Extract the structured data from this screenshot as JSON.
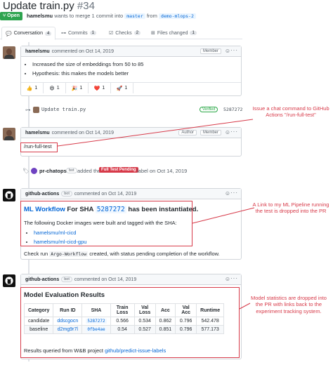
{
  "header": {
    "title": "Update train.py",
    "number": "#34",
    "status": "Open",
    "author": "hamelsmu",
    "merge_text": "wants to merge 1 commit into",
    "base_branch": "master",
    "from_text": "from",
    "head_branch": "demo-mlops-2"
  },
  "tabs": [
    {
      "label": "Conversation",
      "count": "4"
    },
    {
      "label": "Commits",
      "count": "1"
    },
    {
      "label": "Checks",
      "count": "2"
    },
    {
      "label": "Files changed",
      "count": "1"
    }
  ],
  "comment1": {
    "author": "hamelsmu",
    "meta": "commented on Oct 14, 2019",
    "role": "Member",
    "bullets": [
      "Increased the size of embeddings from 50 to 85",
      "Hypothesis: this makes the models better"
    ],
    "reactions": [
      {
        "emoji": "👍",
        "count": "1"
      },
      {
        "emoji": "😄",
        "count": "1"
      },
      {
        "emoji": "🎉",
        "count": "1"
      },
      {
        "emoji": "❤️",
        "count": "1"
      },
      {
        "emoji": "🚀",
        "count": "1"
      }
    ]
  },
  "commit": {
    "message": "Update train.py",
    "verified": "Verified",
    "sha": "5287272"
  },
  "comment2": {
    "author": "hamelsmu",
    "meta": "commented on Oct 14, 2019",
    "role": "Author",
    "role2": "Member",
    "body": "/run-full-test"
  },
  "label_event": {
    "actor": "pr-chatops",
    "bot": "bot",
    "text": "added the",
    "label": "Full Test Pending",
    "suffix": "label on Oct 14, 2019"
  },
  "comment3": {
    "author": "github-actions",
    "bot": "bot",
    "meta": "commented on Oct 14, 2019",
    "heading_link": "ML Workflow",
    "heading_mid": "For SHA",
    "heading_sha": "5287272",
    "heading_end": "has been instantiated.",
    "intro": "The following Docker images were built and tagged with the SHA:",
    "images": [
      "hamelsmu/ml-cicd",
      "hamelsmu/ml-cicd-gpu"
    ],
    "footer_pre": "Check run",
    "footer_code": "Argo-Workflow",
    "footer_post": "created, with status pending completion of the workflow."
  },
  "comment4": {
    "author": "github-actions",
    "bot": "bot",
    "meta": "commented on Oct 14, 2019",
    "heading": "Model Evaluation Results",
    "columns": [
      "Category",
      "Run ID",
      "SHA",
      "Train Loss",
      "Val Loss",
      "Acc",
      "Val Acc",
      "Runtime"
    ],
    "rows": [
      [
        "candidate",
        "ddscgocn",
        "5287272",
        "0.566",
        "0.534",
        "0.862",
        "0.796",
        "542.478"
      ],
      [
        "baseline",
        "d2mg9r7l",
        "0fbe4ae",
        "0.54",
        "0.527",
        "0.851",
        "0.796",
        "577.173"
      ]
    ],
    "footer_pre": "Results queried from W&B project",
    "footer_link": "github/predict-issue-labels"
  },
  "annotations": [
    "Issue a chat command to GitHub Actions \"/run-full-test\"",
    "A Link to my ML Pipeline running the test is dropped into the PR",
    "Model statistics are dropped into the PR with links back to the experiment tracking system."
  ],
  "colors": {
    "accent": "#0366d6",
    "open": "#2ea44f",
    "annotation": "#d73a49",
    "label": "#d73a49"
  }
}
